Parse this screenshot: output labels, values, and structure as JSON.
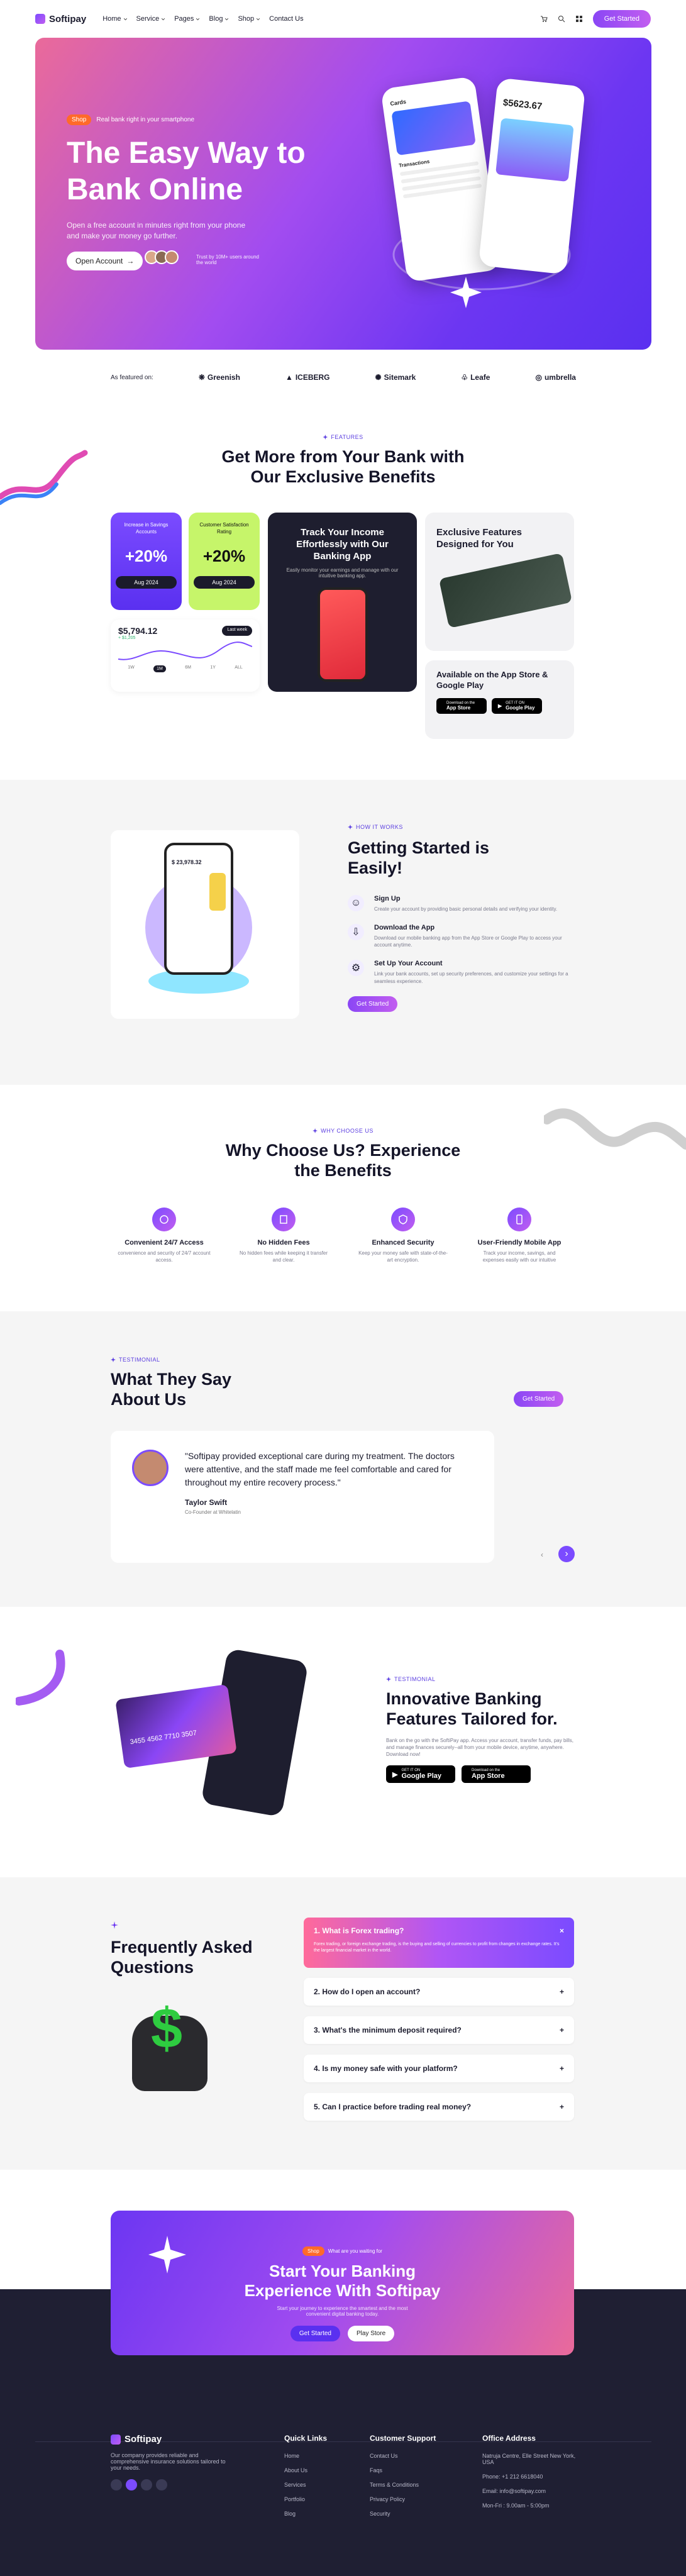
{
  "header": {
    "logo": "Softipay",
    "nav": [
      "Home",
      "Service",
      "Pages",
      "Blog",
      "Shop",
      "Contact Us"
    ],
    "cta": "Get Started"
  },
  "hero": {
    "badge": "Shop",
    "badge_text": "Real bank right in your smartphone",
    "title": "The Easy Way to Bank Online",
    "subtitle": "Open a free account in minutes right from your phone and make your money go further.",
    "open_btn": "Open Account",
    "trust": "Trust by 10M+ users around the world",
    "phone_balance": "$5623.67",
    "card_title": "Cards",
    "transactions": "Transactions"
  },
  "featured": {
    "label": "As featured on:",
    "brands": [
      "Greenish",
      "ICEBERG",
      "Sitemark",
      "Leafe",
      "umbrella"
    ]
  },
  "features": {
    "tag": "FEATURES",
    "title": "Get More from Your Bank with Our Exclusive Benefits",
    "stat1": {
      "label": "Increase in Savings Accounts",
      "value": "+20%",
      "date": "Aug 2024"
    },
    "stat2": {
      "label": "Customer Satisfaction Rating",
      "value": "+20%",
      "date": "Aug 2024"
    },
    "chart": {
      "amount": "$5,794.12",
      "delta": "+ $1,205",
      "period": "Last week",
      "tabs": [
        "1W",
        "1M",
        "6M",
        "1Y",
        "ALL"
      ]
    },
    "track": {
      "title": "Track Your Income Effortlessly with Our Banking App",
      "desc": "Easily monitor your earnings and manage with our intuitive banking app."
    },
    "exclusive": {
      "title": "Exclusive Features Designed for You"
    },
    "available": {
      "title": "Available on the App Store & Google Play"
    }
  },
  "stores": {
    "apple_small": "Download on the",
    "apple": "App Store",
    "google_small": "GET IT ON",
    "google": "Google Play"
  },
  "how": {
    "tag": "HOW IT WORKS",
    "title": "Getting Started is Easily!",
    "phone_amount": "$ 23,978.32",
    "steps": [
      {
        "title": "Sign Up",
        "desc": "Create your account by providing basic personal details and verifying your identity."
      },
      {
        "title": "Download the App",
        "desc": "Download our mobile banking app from the App Store or Google Play to access your account anytime."
      },
      {
        "title": "Set Up Your Account",
        "desc": "Link your bank accounts, set up security preferences, and customize your settings for a seamless experience."
      }
    ],
    "cta": "Get Started"
  },
  "why": {
    "tag": "WHY CHOOSE US",
    "title": "Why Choose Us? Experience the Benefits",
    "items": [
      {
        "title": "Convenient 24/7 Access",
        "desc": "convenience and security of 24/7 account access."
      },
      {
        "title": "No Hidden Fees",
        "desc": "No hidden fees while keeping it transfer and clear."
      },
      {
        "title": "Enhanced Security",
        "desc": "Keep your money safe with state-of-the-art encryption."
      },
      {
        "title": "User-Friendly Mobile App",
        "desc": "Track your income, savings, and expenses easily with our intuitive"
      }
    ]
  },
  "testimonial": {
    "tag": "TESTIMONIAL",
    "title": "What They Say About Us",
    "cta": "Get Started",
    "quote": "\"Softipay provided exceptional care during my treatment. The doctors were attentive, and the staff made me feel comfortable and cared for throughout my entire recovery process.\"",
    "name": "Taylor Swift",
    "role": "Co-Founder at Whitelatin"
  },
  "innov": {
    "tag": "TESTIMONIAL",
    "title": "Innovative Banking Features Tailored for.",
    "desc": "Bank on the go with the SoftiPay app. Access your account, transfer funds, pay bills, and manage finances securely--all from your mobile device, anytime, anywhere. Download now!",
    "card_number": "3455 4562 7710 3507"
  },
  "faq": {
    "title": "Frequently Asked Questions",
    "active_q": "1. What is Forex trading?",
    "active_a": "Forex trading, or foreign exchange trading, is the buying and selling of currencies to profit from changes in exchange rates. It's the largest financial market in the world.",
    "questions": [
      "2. How do I open an account?",
      "3. What's the minimum deposit required?",
      "4. Is my money safe with your platform?",
      "5. Can I practice before trading real money?"
    ]
  },
  "cta": {
    "badge": "Shop",
    "badge_text": "What are you waiting for",
    "title": "Start Your Banking Experience With Softipay",
    "desc": "Start your journey to experience the smartest and the most convenient digital banking today.",
    "btn1": "Get Started",
    "btn2": "Play Store"
  },
  "footer": {
    "logo": "Softipay",
    "desc": "Our company provides reliable and comprehensive insurance solutions tailored to your needs.",
    "quick_title": "Quick Links",
    "quick": [
      "Home",
      "About Us",
      "Services",
      "Portfolio",
      "Blog"
    ],
    "support_title": "Customer Support",
    "support": [
      "Contact Us",
      "Faqs",
      "Terms & Conditions",
      "Privacy Policy",
      "Security"
    ],
    "office_title": "Office Address",
    "office": [
      "Natruja Centre, Elle Street New York, USA",
      "Phone: +1 212 6618040",
      "Email: info@softipay.com",
      "Mon-Fri : 9.00am - 5:00pm"
    ]
  },
  "colors": {
    "purple": "#6c36f2",
    "pink": "#ea6a9a",
    "lime": "#c6f56a",
    "orange": "#ff6a2a",
    "footer": "#1f1f33"
  }
}
